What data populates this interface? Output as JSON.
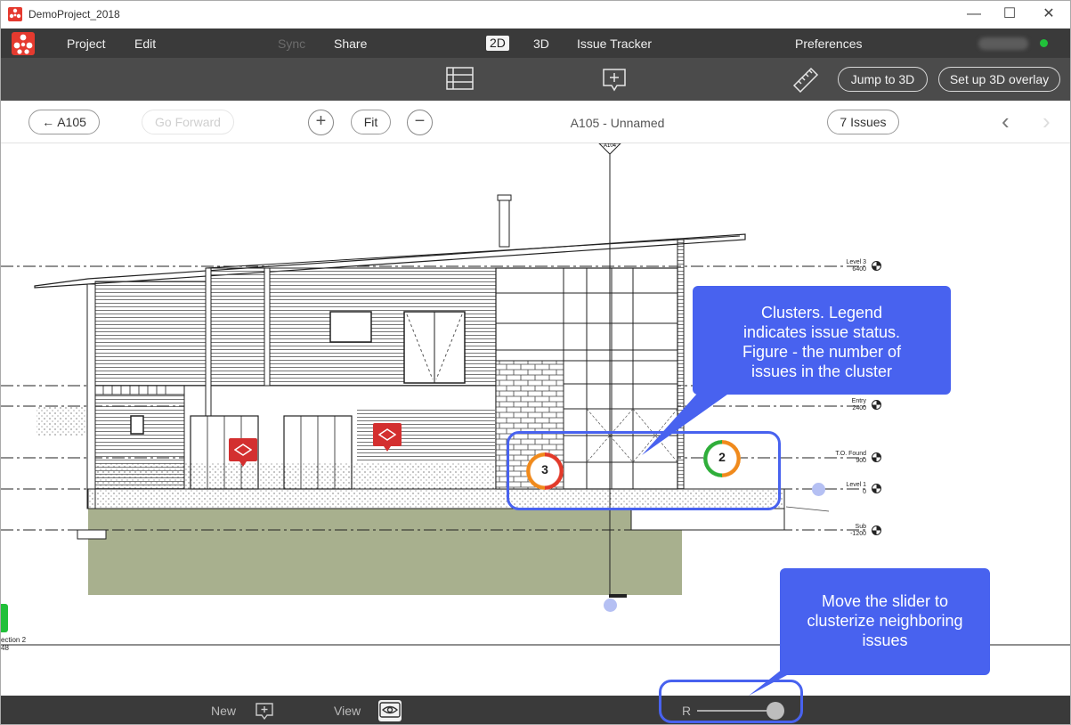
{
  "window": {
    "title": "DemoProject_2018",
    "min_glyph": "—",
    "max_glyph": "☐",
    "close_glyph": "✕"
  },
  "menu": {
    "project": "Project",
    "edit": "Edit",
    "sync": "Sync",
    "share": "Share",
    "mode_2d": "2D",
    "mode_3d": "3D",
    "issue_tracker": "Issue Tracker",
    "preferences": "Preferences"
  },
  "toolbar": {
    "jump_to_3d": "Jump to 3D",
    "setup_overlay": "Set up 3D overlay"
  },
  "nav": {
    "back": "← A105",
    "forward": "Go Forward",
    "zoom_in": "+",
    "fit": "Fit",
    "zoom_out": "−",
    "view_title": "A105 - Unnamed",
    "issues": "7 Issues",
    "prev": "‹",
    "next": "›"
  },
  "drawing": {
    "top_marker": "A104",
    "levels": [
      {
        "name": "Level 3",
        "value": "6400"
      },
      {
        "name": "Entry",
        "value": "2400"
      },
      {
        "name": "T.O. Found",
        "value": "900"
      },
      {
        "name": "Level 1",
        "value": "0"
      },
      {
        "name": "Sub",
        "value": "-1200"
      }
    ],
    "section_label_1": "ection 2",
    "section_label_2": "48"
  },
  "clusters": [
    {
      "count": "3",
      "status_colors": [
        "#e23a2a",
        "#f08a1c"
      ]
    },
    {
      "count": "2",
      "status_colors": [
        "#f08a1c",
        "#2fae3a"
      ]
    }
  ],
  "callouts": {
    "clusters": "Clusters. Legend indicates issue status. Figure - the number of issues in the cluster",
    "slider": "Move the slider to clusterize neighboring issues"
  },
  "bottom": {
    "new_label": "New",
    "view_label": "View",
    "slider_label": "R"
  },
  "colors": {
    "accent": "#4862ef",
    "issue_red": "#d32f2f",
    "ground_fill": "#a8b08e",
    "status_green": "#21c03a"
  }
}
